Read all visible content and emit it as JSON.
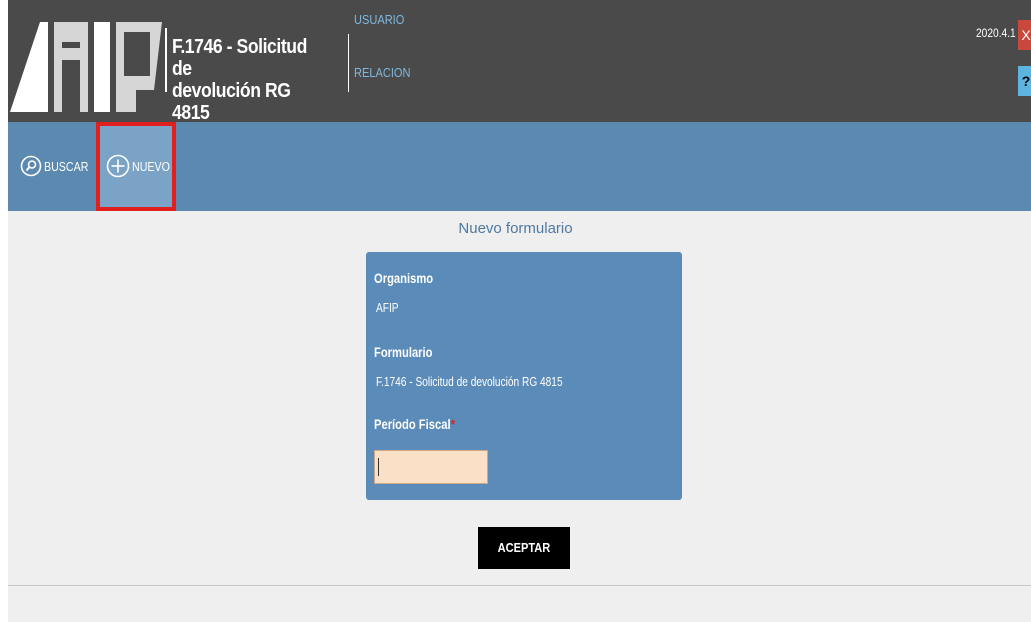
{
  "header": {
    "logo_text": "AFIP",
    "app_title": "F.1746 - Solicitud de\ndevolución RG 4815",
    "nav": {
      "usuario": "USUARIO",
      "relacion": "RELACION"
    },
    "version": "2020.4.1",
    "close_label": "X",
    "help_label": "?"
  },
  "toolbar": {
    "buscar_label": "BUSCAR",
    "nuevo_label": "NUEVO",
    "buscar_icon": "search-icon",
    "nuevo_icon": "plus-circle-icon"
  },
  "form": {
    "title": "Nuevo formulario",
    "organismo_label": "Organismo",
    "organismo_value": "AFIP",
    "formulario_label": "Formulario",
    "formulario_value": "F.1746 - Solicitud de devolución RG 4815",
    "periodo_label": "Período Fiscal",
    "required_mark": "*",
    "periodo_value": "",
    "submit_label": "ACEPTAR"
  },
  "colors": {
    "header_bg": "#4a4a4a",
    "toolbar_bg": "#5b89b0",
    "panel_bg": "#5b8bb8",
    "highlight_border": "#e01f1f",
    "input_bg": "#fbe0c8",
    "link": "#7fb8e0"
  }
}
